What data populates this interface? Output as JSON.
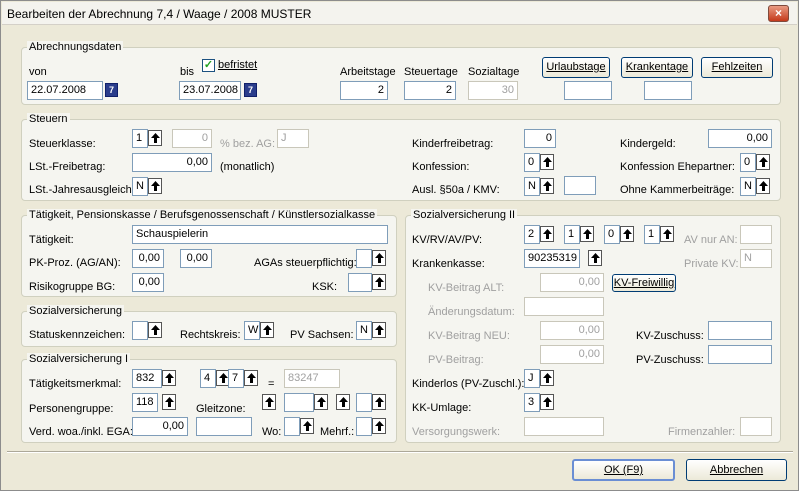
{
  "window": {
    "title": "Bearbeiten der Abrechnung 7,4 / Waage / 2008 MUSTER",
    "close": "×"
  },
  "abrechnung": {
    "group_title": "Abrechnungsdaten",
    "von_label": "von",
    "von_value": "22.07.2008",
    "bis_label": "bis",
    "bis_value": "23.07.2008",
    "befristet_label": "befristet",
    "befristet_checked": "✓",
    "arbeitstage_label": "Arbeitstage",
    "arbeitstage_value": "2",
    "steuertage_label": "Steuertage",
    "steuertage_value": "2",
    "sozialtage_label": "Sozialtage",
    "sozialtage_value": "30",
    "urlaubstage_btn": "Urlaubstage",
    "krankentage_btn": "Krankentage",
    "fehlzeiten_btn": "Fehlzeiten",
    "calendar_icon": "7"
  },
  "steuern": {
    "group_title": "Steuern",
    "steuerklasse_label": "Steuerklasse:",
    "steuerklasse_value": "1",
    "steuerklasse_pct": "0",
    "bez_ag_label": "% bez. AG:",
    "bez_ag_value": "J",
    "freibetrag_label": "LSt.-Freibetrag:",
    "freibetrag_value": "0,00",
    "monatlich": "(monatlich)",
    "jahresausgleich_label": "LSt.-Jahresausgleich:",
    "jahresausgleich_value": "N",
    "kinderfreibetrag_label": "Kinderfreibetrag:",
    "kinderfreibetrag_value": "0",
    "konfession_label": "Konfession:",
    "konfession_value": "0",
    "ausl_label": "Ausl. §50a / KMV:",
    "ausl_value": "N",
    "kindergeld_label": "Kindergeld:",
    "kindergeld_value": "0,00",
    "konf_ehe_label": "Konfession Ehepartner:",
    "konf_ehe_value": "0",
    "kammer_label": "Ohne Kammerbeiträge:",
    "kammer_value": "N"
  },
  "taetigkeit": {
    "group_title": "Tätigkeit, Pensionskasse / Berufsgenossenschaft / Künstlersozialkasse",
    "taetigkeit_label": "Tätigkeit:",
    "taetigkeit_value": "Schauspielerin",
    "pk_label": "PK-Proz. (AG/AN):",
    "pk_ag": "0,00",
    "pk_an": "0,00",
    "agas_label": "AGAs steuerpflichtig:",
    "risiko_label": "Risikogruppe BG:",
    "risiko_value": "0,00",
    "ksk_label": "KSK:"
  },
  "sozial": {
    "group_title": "Sozialversicherung",
    "status_label": "Statuskennzeichen:",
    "rechtskreis_label": "Rechtskreis:",
    "rechtskreis_value": "W",
    "pv_sachsen_label": "PV Sachsen:",
    "pv_sachsen_value": "N"
  },
  "sozial1": {
    "group_title": "Sozialversicherung I",
    "tm_label": "Tätigkeitsmerkmal:",
    "tm_1": "832",
    "tm_2": "4",
    "tm_3": "7",
    "tm_eq": "=",
    "tm_result": "83247",
    "pg_label": "Personengruppe:",
    "pg_value": "118",
    "gleitzone_label": "Gleitzone:",
    "verd_label": "Verd. woa./inkl. EGA:",
    "verd_value": "0,00",
    "wo_label": "Wo:",
    "mehrf_label": "Mehrf.:"
  },
  "sozial2": {
    "group_title": "Sozialversicherung II",
    "kv_label": "KV/RV/AV/PV:",
    "kv": "2",
    "rv": "1",
    "av": "0",
    "pv": "1",
    "av_nur_an_label": "AV nur AN:",
    "kk_label": "Krankenkasse:",
    "kk_value": "90235319",
    "private_kv_label": "Private KV:",
    "private_kv_value": "N",
    "kv_alt_label": "KV-Beitrag ALT:",
    "kv_alt_value": "0,00",
    "kv_freiwillig_btn": "KV-Freiwillig",
    "aenderung_label": "Änderungsdatum:",
    "kv_neu_label": "KV-Beitrag NEU:",
    "kv_neu_value": "0,00",
    "pv_beitrag_label": "PV-Beitrag:",
    "pv_beitrag_value": "0,00",
    "kv_zuschuss_label": "KV-Zuschuss:",
    "pv_zuschuss_label": "PV-Zuschuss:",
    "kinderlos_label": "Kinderlos (PV-Zuschl.):",
    "kinderlos_value": "J",
    "kk_umlage_label": "KK-Umlage:",
    "kk_umlage_value": "3",
    "versorgung_label": "Versorgungswerk:",
    "firmenzahler_label": "Firmenzahler:"
  },
  "buttons": {
    "ok": "OK (F9)",
    "cancel": "Abbrechen"
  }
}
